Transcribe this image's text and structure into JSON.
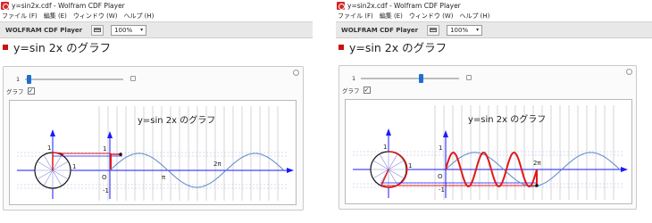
{
  "windows": [
    {
      "title": "y=sin2x.cdf - Wolfram CDF Player",
      "menu": [
        "ファイル (F)",
        "編集 (E)",
        "ウィンドウ (W)",
        "ヘルプ (H)"
      ],
      "brand": "WOLFRAM CDF Player",
      "zoom": "100%",
      "heading": "y=sin 2x のグラフ",
      "slider_label": "1",
      "slider_fraction": 0.02,
      "checkbox_label": "グラフ",
      "checkbox_checked": "✓",
      "plot_title": "y=sin 2x のグラフ",
      "ticks": {
        "one": "1",
        "minus_one": "-1",
        "origin": "O",
        "pi": "π",
        "two_pi": "2π"
      },
      "red_graph_shown": false
    },
    {
      "title": "y=sin2x.cdf - Wolfram CDF Player",
      "menu": [
        "ファイル (F)",
        "編集 (E)",
        "ウィンドウ (W)",
        "ヘルプ (H)"
      ],
      "brand": "WOLFRAM CDF Player",
      "zoom": "100%",
      "heading": "y=sin 2x のグラフ",
      "slider_label": "1",
      "slider_fraction": 0.62,
      "checkbox_label": "グラフ",
      "checkbox_checked": "✓",
      "plot_title": "y=sin 2x のグラフ",
      "ticks": {
        "one": "1",
        "minus_one": "-1",
        "origin": "O",
        "pi": "π",
        "two_pi": "2π"
      },
      "red_graph_shown": true
    }
  ],
  "colors": {
    "accent": "#1f6fd1",
    "red": "#e01818",
    "blue_curve": "#5b86c9",
    "axis": "#1a1aff"
  }
}
